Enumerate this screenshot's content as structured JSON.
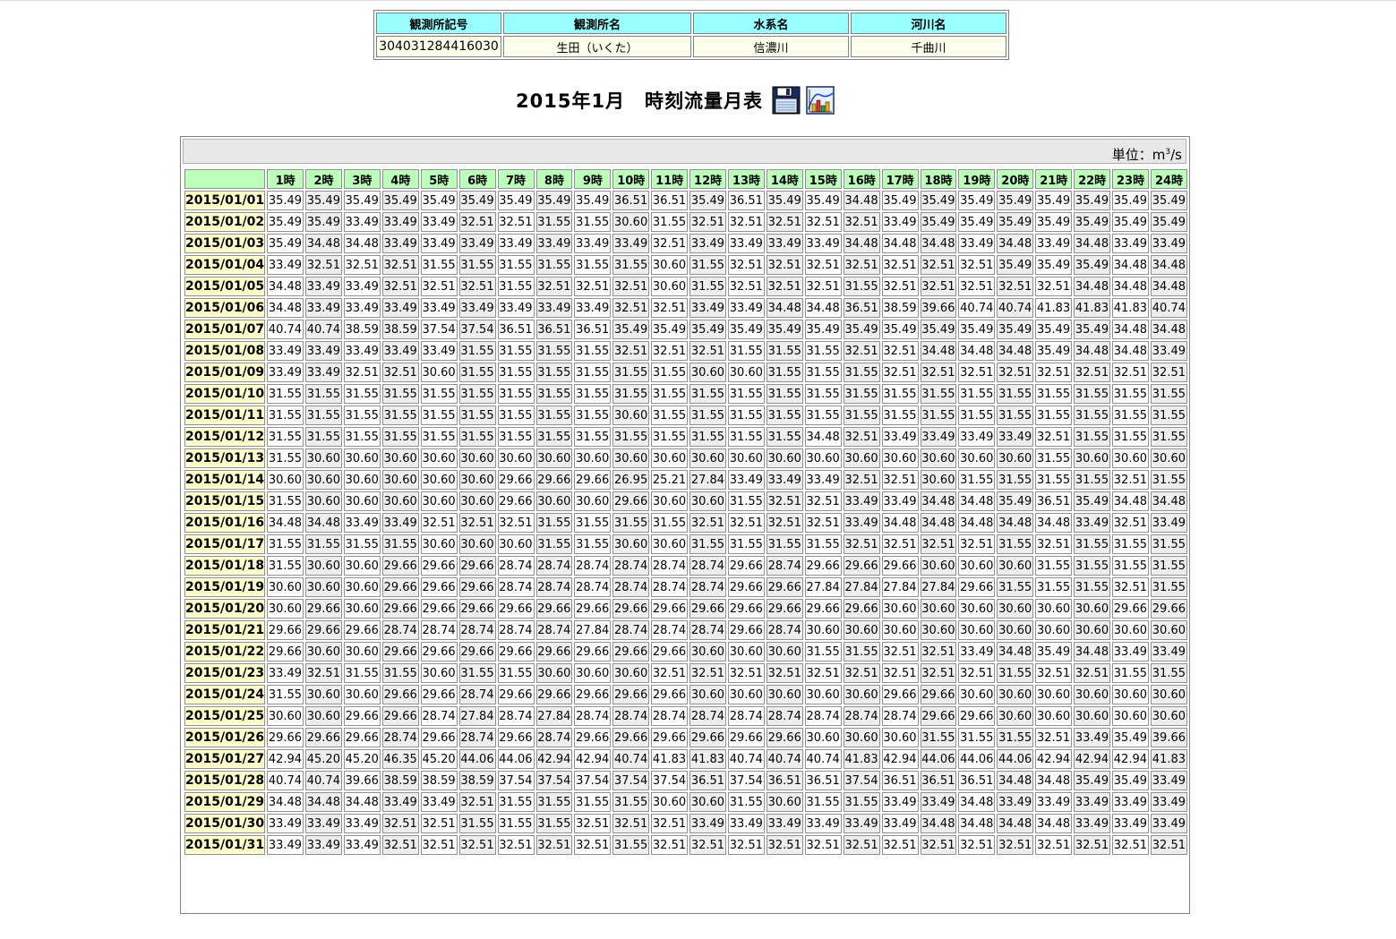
{
  "info": {
    "headers": [
      "観測所記号",
      "観測所名",
      "水系名",
      "河川名"
    ],
    "values": [
      "304031284416030",
      "生田（いくた）",
      "信濃川",
      "千曲川"
    ]
  },
  "title": "2015年1月　時刻流量月表",
  "icons": [
    "save-icon",
    "chart-icon"
  ],
  "unit": {
    "prefix": "単位：m",
    "sup": "3",
    "suffix": "/s"
  },
  "table": {
    "hours": [
      "1時",
      "2時",
      "3時",
      "4時",
      "5時",
      "6時",
      "7時",
      "8時",
      "9時",
      "10時",
      "11時",
      "12時",
      "13時",
      "14時",
      "15時",
      "16時",
      "17時",
      "18時",
      "19時",
      "20時",
      "21時",
      "22時",
      "23時",
      "24時"
    ],
    "rows": [
      {
        "date": "2015/01/01",
        "values": [
          "35.49",
          "35.49",
          "35.49",
          "35.49",
          "35.49",
          "35.49",
          "35.49",
          "35.49",
          "35.49",
          "36.51",
          "36.51",
          "35.49",
          "36.51",
          "35.49",
          "35.49",
          "34.48",
          "35.49",
          "35.49",
          "35.49",
          "35.49",
          "35.49",
          "35.49",
          "35.49",
          "35.49"
        ]
      },
      {
        "date": "2015/01/02",
        "values": [
          "35.49",
          "35.49",
          "33.49",
          "33.49",
          "33.49",
          "32.51",
          "32.51",
          "31.55",
          "31.55",
          "30.60",
          "31.55",
          "32.51",
          "32.51",
          "32.51",
          "32.51",
          "32.51",
          "33.49",
          "35.49",
          "35.49",
          "35.49",
          "35.49",
          "35.49",
          "35.49",
          "35.49"
        ]
      },
      {
        "date": "2015/01/03",
        "values": [
          "35.49",
          "34.48",
          "34.48",
          "33.49",
          "33.49",
          "33.49",
          "33.49",
          "33.49",
          "33.49",
          "33.49",
          "32.51",
          "33.49",
          "33.49",
          "33.49",
          "33.49",
          "34.48",
          "34.48",
          "34.48",
          "33.49",
          "34.48",
          "33.49",
          "34.48",
          "33.49",
          "33.49"
        ]
      },
      {
        "date": "2015/01/04",
        "values": [
          "33.49",
          "32.51",
          "32.51",
          "32.51",
          "31.55",
          "31.55",
          "31.55",
          "31.55",
          "31.55",
          "31.55",
          "30.60",
          "31.55",
          "32.51",
          "32.51",
          "32.51",
          "32.51",
          "32.51",
          "32.51",
          "32.51",
          "35.49",
          "35.49",
          "35.49",
          "34.48",
          "34.48"
        ]
      },
      {
        "date": "2015/01/05",
        "values": [
          "34.48",
          "33.49",
          "33.49",
          "32.51",
          "32.51",
          "32.51",
          "31.55",
          "32.51",
          "32.51",
          "32.51",
          "30.60",
          "31.55",
          "32.51",
          "32.51",
          "32.51",
          "31.55",
          "32.51",
          "32.51",
          "32.51",
          "32.51",
          "32.51",
          "34.48",
          "34.48",
          "34.48"
        ]
      },
      {
        "date": "2015/01/06",
        "values": [
          "34.48",
          "33.49",
          "33.49",
          "33.49",
          "33.49",
          "33.49",
          "33.49",
          "33.49",
          "33.49",
          "32.51",
          "32.51",
          "33.49",
          "33.49",
          "34.48",
          "34.48",
          "36.51",
          "38.59",
          "39.66",
          "40.74",
          "40.74",
          "41.83",
          "41.83",
          "41.83",
          "40.74"
        ]
      },
      {
        "date": "2015/01/07",
        "values": [
          "40.74",
          "40.74",
          "38.59",
          "38.59",
          "37.54",
          "37.54",
          "36.51",
          "36.51",
          "36.51",
          "35.49",
          "35.49",
          "35.49",
          "35.49",
          "35.49",
          "35.49",
          "35.49",
          "35.49",
          "35.49",
          "35.49",
          "35.49",
          "35.49",
          "35.49",
          "34.48",
          "34.48"
        ]
      },
      {
        "date": "2015/01/08",
        "values": [
          "33.49",
          "33.49",
          "33.49",
          "33.49",
          "33.49",
          "31.55",
          "31.55",
          "31.55",
          "31.55",
          "32.51",
          "32.51",
          "32.51",
          "31.55",
          "31.55",
          "31.55",
          "32.51",
          "32.51",
          "34.48",
          "34.48",
          "34.48",
          "35.49",
          "34.48",
          "34.48",
          "33.49"
        ]
      },
      {
        "date": "2015/01/09",
        "values": [
          "33.49",
          "33.49",
          "32.51",
          "32.51",
          "30.60",
          "31.55",
          "31.55",
          "31.55",
          "31.55",
          "31.55",
          "31.55",
          "30.60",
          "30.60",
          "31.55",
          "31.55",
          "31.55",
          "32.51",
          "32.51",
          "32.51",
          "32.51",
          "32.51",
          "32.51",
          "32.51",
          "32.51"
        ]
      },
      {
        "date": "2015/01/10",
        "values": [
          "31.55",
          "31.55",
          "31.55",
          "31.55",
          "31.55",
          "31.55",
          "31.55",
          "31.55",
          "31.55",
          "31.55",
          "31.55",
          "31.55",
          "31.55",
          "31.55",
          "31.55",
          "31.55",
          "31.55",
          "31.55",
          "31.55",
          "31.55",
          "31.55",
          "31.55",
          "31.55",
          "31.55"
        ]
      },
      {
        "date": "2015/01/11",
        "values": [
          "31.55",
          "31.55",
          "31.55",
          "31.55",
          "31.55",
          "31.55",
          "31.55",
          "31.55",
          "31.55",
          "30.60",
          "31.55",
          "31.55",
          "31.55",
          "31.55",
          "31.55",
          "31.55",
          "31.55",
          "31.55",
          "31.55",
          "31.55",
          "31.55",
          "31.55",
          "31.55",
          "31.55"
        ]
      },
      {
        "date": "2015/01/12",
        "values": [
          "31.55",
          "31.55",
          "31.55",
          "31.55",
          "31.55",
          "31.55",
          "31.55",
          "31.55",
          "31.55",
          "31.55",
          "31.55",
          "31.55",
          "31.55",
          "31.55",
          "34.48",
          "32.51",
          "33.49",
          "33.49",
          "33.49",
          "33.49",
          "32.51",
          "31.55",
          "31.55",
          "31.55"
        ]
      },
      {
        "date": "2015/01/13",
        "values": [
          "31.55",
          "30.60",
          "30.60",
          "30.60",
          "30.60",
          "30.60",
          "30.60",
          "30.60",
          "30.60",
          "30.60",
          "30.60",
          "30.60",
          "30.60",
          "30.60",
          "30.60",
          "30.60",
          "30.60",
          "30.60",
          "30.60",
          "30.60",
          "31.55",
          "30.60",
          "30.60",
          "30.60"
        ]
      },
      {
        "date": "2015/01/14",
        "values": [
          "30.60",
          "30.60",
          "30.60",
          "30.60",
          "30.60",
          "30.60",
          "29.66",
          "29.66",
          "29.66",
          "26.95",
          "25.21",
          "27.84",
          "33.49",
          "33.49",
          "33.49",
          "32.51",
          "32.51",
          "30.60",
          "31.55",
          "31.55",
          "31.55",
          "31.55",
          "32.51",
          "31.55"
        ]
      },
      {
        "date": "2015/01/15",
        "values": [
          "31.55",
          "30.60",
          "30.60",
          "30.60",
          "30.60",
          "30.60",
          "29.66",
          "30.60",
          "30.60",
          "29.66",
          "30.60",
          "30.60",
          "31.55",
          "32.51",
          "32.51",
          "33.49",
          "33.49",
          "34.48",
          "34.48",
          "35.49",
          "36.51",
          "35.49",
          "34.48",
          "34.48"
        ]
      },
      {
        "date": "2015/01/16",
        "values": [
          "34.48",
          "34.48",
          "33.49",
          "33.49",
          "32.51",
          "32.51",
          "32.51",
          "31.55",
          "31.55",
          "31.55",
          "31.55",
          "32.51",
          "32.51",
          "32.51",
          "32.51",
          "33.49",
          "34.48",
          "34.48",
          "34.48",
          "34.48",
          "34.48",
          "33.49",
          "32.51",
          "33.49"
        ]
      },
      {
        "date": "2015/01/17",
        "values": [
          "31.55",
          "31.55",
          "31.55",
          "31.55",
          "30.60",
          "30.60",
          "30.60",
          "31.55",
          "31.55",
          "30.60",
          "30.60",
          "31.55",
          "31.55",
          "31.55",
          "31.55",
          "32.51",
          "32.51",
          "32.51",
          "32.51",
          "31.55",
          "32.51",
          "31.55",
          "31.55",
          "31.55"
        ]
      },
      {
        "date": "2015/01/18",
        "values": [
          "31.55",
          "30.60",
          "30.60",
          "29.66",
          "29.66",
          "29.66",
          "28.74",
          "28.74",
          "28.74",
          "28.74",
          "28.74",
          "28.74",
          "29.66",
          "28.74",
          "29.66",
          "29.66",
          "29.66",
          "30.60",
          "30.60",
          "30.60",
          "31.55",
          "31.55",
          "31.55",
          "31.55"
        ]
      },
      {
        "date": "2015/01/19",
        "values": [
          "30.60",
          "30.60",
          "30.60",
          "29.66",
          "29.66",
          "29.66",
          "28.74",
          "28.74",
          "28.74",
          "28.74",
          "28.74",
          "28.74",
          "29.66",
          "29.66",
          "27.84",
          "27.84",
          "27.84",
          "27.84",
          "29.66",
          "31.55",
          "31.55",
          "31.55",
          "32.51",
          "31.55"
        ]
      },
      {
        "date": "2015/01/20",
        "values": [
          "30.60",
          "29.66",
          "30.60",
          "29.66",
          "29.66",
          "29.66",
          "29.66",
          "29.66",
          "29.66",
          "29.66",
          "29.66",
          "29.66",
          "29.66",
          "29.66",
          "29.66",
          "29.66",
          "30.60",
          "30.60",
          "30.60",
          "30.60",
          "30.60",
          "30.60",
          "29.66",
          "29.66"
        ]
      },
      {
        "date": "2015/01/21",
        "values": [
          "29.66",
          "29.66",
          "29.66",
          "28.74",
          "28.74",
          "28.74",
          "28.74",
          "28.74",
          "27.84",
          "28.74",
          "28.74",
          "28.74",
          "29.66",
          "28.74",
          "30.60",
          "30.60",
          "30.60",
          "30.60",
          "30.60",
          "30.60",
          "30.60",
          "30.60",
          "30.60",
          "30.60"
        ]
      },
      {
        "date": "2015/01/22",
        "values": [
          "29.66",
          "30.60",
          "30.60",
          "29.66",
          "29.66",
          "29.66",
          "29.66",
          "29.66",
          "29.66",
          "29.66",
          "29.66",
          "30.60",
          "30.60",
          "30.60",
          "31.55",
          "31.55",
          "32.51",
          "32.51",
          "33.49",
          "34.48",
          "35.49",
          "34.48",
          "33.49",
          "33.49"
        ]
      },
      {
        "date": "2015/01/23",
        "values": [
          "33.49",
          "32.51",
          "31.55",
          "31.55",
          "30.60",
          "31.55",
          "31.55",
          "30.60",
          "30.60",
          "30.60",
          "32.51",
          "32.51",
          "32.51",
          "32.51",
          "32.51",
          "32.51",
          "32.51",
          "32.51",
          "32.51",
          "31.55",
          "32.51",
          "32.51",
          "31.55",
          "31.55"
        ]
      },
      {
        "date": "2015/01/24",
        "values": [
          "31.55",
          "30.60",
          "30.60",
          "29.66",
          "29.66",
          "28.74",
          "29.66",
          "29.66",
          "29.66",
          "29.66",
          "29.66",
          "30.60",
          "30.60",
          "30.60",
          "30.60",
          "30.60",
          "29.66",
          "29.66",
          "30.60",
          "30.60",
          "30.60",
          "30.60",
          "30.60",
          "30.60"
        ]
      },
      {
        "date": "2015/01/25",
        "values": [
          "30.60",
          "30.60",
          "29.66",
          "29.66",
          "28.74",
          "27.84",
          "28.74",
          "27.84",
          "28.74",
          "28.74",
          "28.74",
          "28.74",
          "28.74",
          "28.74",
          "28.74",
          "28.74",
          "28.74",
          "29.66",
          "29.66",
          "30.60",
          "30.60",
          "30.60",
          "30.60",
          "30.60"
        ]
      },
      {
        "date": "2015/01/26",
        "values": [
          "29.66",
          "29.66",
          "29.66",
          "28.74",
          "29.66",
          "28.74",
          "29.66",
          "28.74",
          "29.66",
          "29.66",
          "29.66",
          "29.66",
          "29.66",
          "29.66",
          "30.60",
          "30.60",
          "30.60",
          "31.55",
          "31.55",
          "31.55",
          "32.51",
          "33.49",
          "35.49",
          "39.66"
        ]
      },
      {
        "date": "2015/01/27",
        "values": [
          "42.94",
          "45.20",
          "45.20",
          "46.35",
          "45.20",
          "44.06",
          "44.06",
          "42.94",
          "42.94",
          "40.74",
          "41.83",
          "41.83",
          "40.74",
          "40.74",
          "40.74",
          "41.83",
          "42.94",
          "44.06",
          "44.06",
          "44.06",
          "42.94",
          "42.94",
          "42.94",
          "41.83"
        ]
      },
      {
        "date": "2015/01/28",
        "values": [
          "40.74",
          "40.74",
          "39.66",
          "38.59",
          "38.59",
          "38.59",
          "37.54",
          "37.54",
          "37.54",
          "37.54",
          "37.54",
          "36.51",
          "37.54",
          "36.51",
          "36.51",
          "37.54",
          "36.51",
          "36.51",
          "36.51",
          "34.48",
          "34.48",
          "35.49",
          "35.49",
          "33.49"
        ]
      },
      {
        "date": "2015/01/29",
        "values": [
          "34.48",
          "34.48",
          "34.48",
          "33.49",
          "33.49",
          "32.51",
          "31.55",
          "31.55",
          "31.55",
          "31.55",
          "30.60",
          "30.60",
          "31.55",
          "30.60",
          "31.55",
          "31.55",
          "33.49",
          "33.49",
          "34.48",
          "33.49",
          "33.49",
          "33.49",
          "33.49",
          "33.49"
        ]
      },
      {
        "date": "2015/01/30",
        "values": [
          "33.49",
          "33.49",
          "33.49",
          "32.51",
          "32.51",
          "31.55",
          "31.55",
          "31.55",
          "32.51",
          "32.51",
          "32.51",
          "33.49",
          "33.49",
          "33.49",
          "33.49",
          "33.49",
          "33.49",
          "34.48",
          "34.48",
          "34.48",
          "34.48",
          "33.49",
          "33.49",
          "33.49"
        ]
      },
      {
        "date": "2015/01/31",
        "values": [
          "33.49",
          "33.49",
          "33.49",
          "32.51",
          "32.51",
          "32.51",
          "32.51",
          "32.51",
          "32.51",
          "31.55",
          "32.51",
          "32.51",
          "32.51",
          "32.51",
          "32.51",
          "32.51",
          "32.51",
          "32.51",
          "32.51",
          "32.51",
          "32.51",
          "32.51",
          "32.51",
          "32.51"
        ]
      }
    ]
  }
}
